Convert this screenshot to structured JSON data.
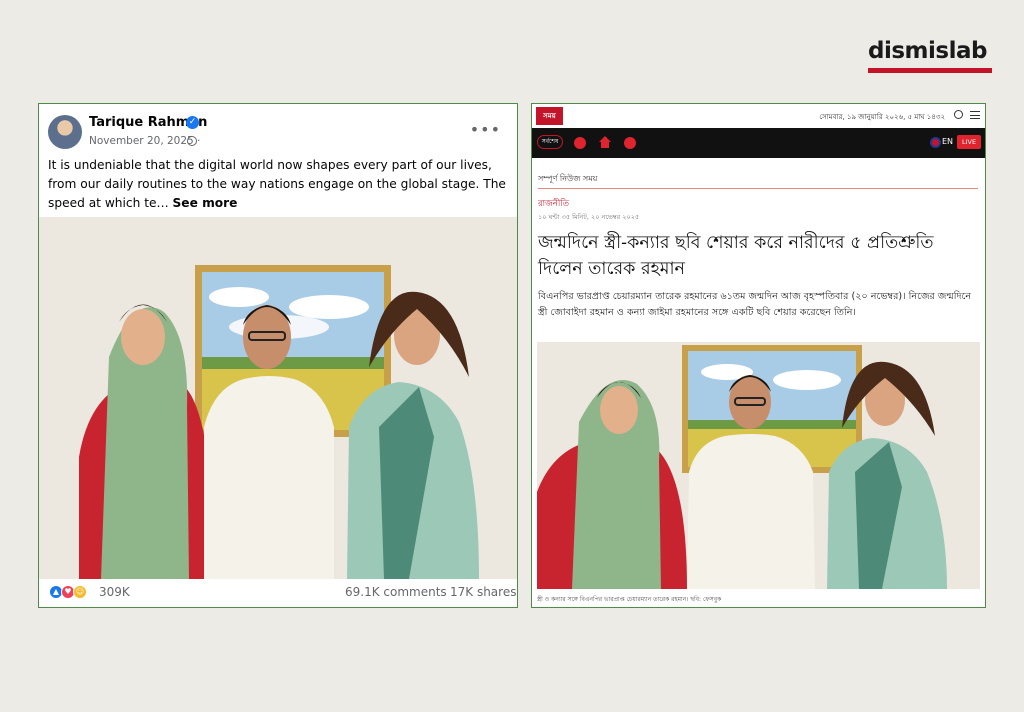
{
  "brand": {
    "name": "dismislab"
  },
  "facebook_post": {
    "author": "Tarique Rahman",
    "date": "November 20, 2025 ·",
    "text": "It is undeniable that the digital world now shapes every part of our lives, from our daily routines to the way nations engage on the global stage. The speed at which te…",
    "see_more": "See more",
    "reaction_count": "309K",
    "comments": "69.1K comments",
    "shares": "17K shares",
    "more_icon": "•••",
    "verified_icon": "✓"
  },
  "news_article": {
    "site_logo": "সময়",
    "date_bar": "সোমবার, ১৯ জানুয়ারি ২০২৬, ৫ মাঘ ১৪৩২",
    "nav_pill": "সর্বশেষ",
    "language": "EN",
    "live": "LIVE",
    "section": "সম্পূর্ণ নিউজ সময়",
    "category": "রাজনীতি",
    "timestamp": "১০ ঘন্টা ৩৫ মিনিট, ২০ নভেম্বর ২০২৫",
    "headline": "জন্মদিনে স্ত্রী-কন্যার ছবি শেয়ার করে নারীদের ৫ প্রতিশ্রুতি দিলেন তারেক রহমান",
    "body": "বিএনপির ভারপ্রাপ্ত চেয়ারম্যান তারেক রহমানের ৬১তম জন্মদিন আজ বৃহস্পতিবার (২০ নভেম্বর)। নিজের জন্মদিনে স্ত্রী জোবাইদা রহমান ও কন্যা জাইমা রহমানের সঙ্গে একটি ছবি শেয়ার করেছেন তিনি।",
    "caption": "স্ত্রী ও কন্যার সঙ্গে বিএনপির ভারপ্রাপ্ত চেয়ারম্যান তারেক রহমান। ছবি: ফেসবুক"
  }
}
